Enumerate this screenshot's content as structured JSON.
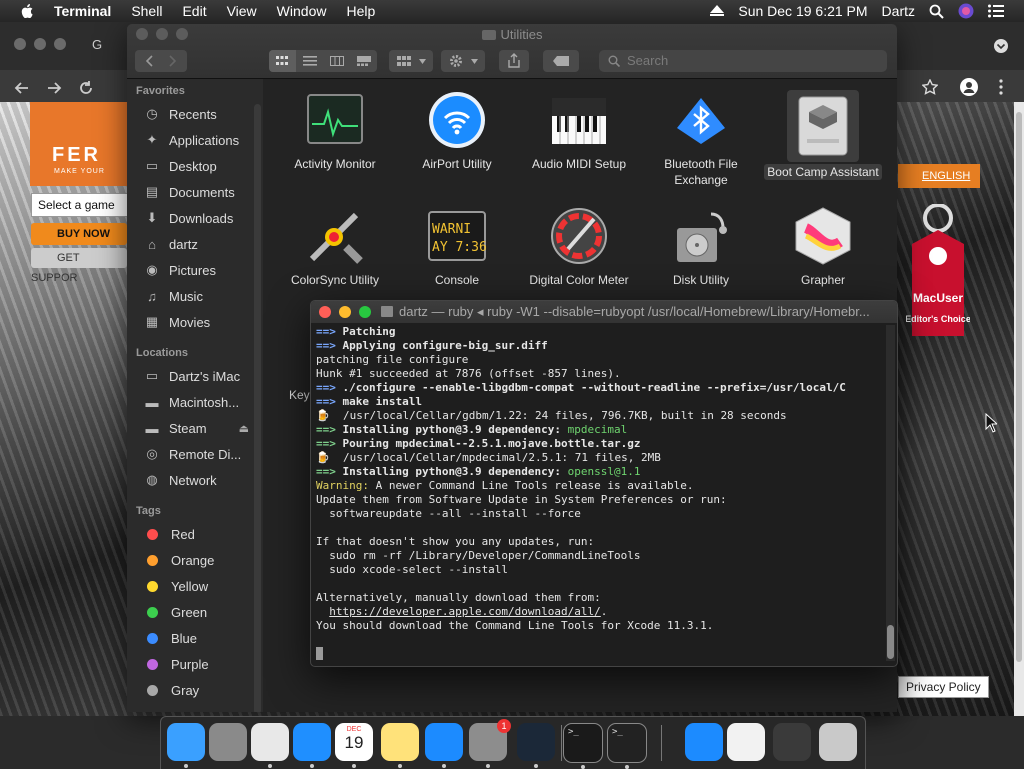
{
  "menubar": {
    "app_name": "Terminal",
    "items": [
      "Shell",
      "Edit",
      "View",
      "Window",
      "Help"
    ],
    "clock": "Sun Dec 19  6:21 PM",
    "user": "Dartz"
  },
  "browser": {
    "tab_label": "G",
    "english_label": "ENGLISH",
    "select_game": "Select a game",
    "buy_now": "BUY NOW",
    "get_support": "GET SUPPOR",
    "ferrari_text": "FER",
    "ferrari_sub": "MAKE YOUR",
    "macuser_title": "MacUser",
    "macuser_sub": "Editor's Choice",
    "privacy": "Privacy Policy"
  },
  "finder": {
    "title": "Utilities",
    "search_placeholder": "Search",
    "sidebar": {
      "favorites_header": "Favorites",
      "favorites": [
        {
          "label": "Recents",
          "icon": "clock-icon"
        },
        {
          "label": "Applications",
          "icon": "applications-icon"
        },
        {
          "label": "Desktop",
          "icon": "desktop-icon"
        },
        {
          "label": "Documents",
          "icon": "document-icon"
        },
        {
          "label": "Downloads",
          "icon": "download-icon"
        },
        {
          "label": "dartz",
          "icon": "home-icon"
        },
        {
          "label": "Pictures",
          "icon": "camera-icon"
        },
        {
          "label": "Music",
          "icon": "music-icon"
        },
        {
          "label": "Movies",
          "icon": "film-icon"
        }
      ],
      "locations_header": "Locations",
      "locations": [
        {
          "label": "Dartz's iMac",
          "icon": "imac-icon"
        },
        {
          "label": "Macintosh...",
          "icon": "disk-icon"
        },
        {
          "label": "Steam",
          "icon": "disk-icon"
        },
        {
          "label": "Remote Di...",
          "icon": "disc-icon"
        },
        {
          "label": "Network",
          "icon": "network-icon"
        }
      ],
      "tags_header": "Tags",
      "tags": [
        {
          "label": "Red",
          "color": "#ff4d4d"
        },
        {
          "label": "Orange",
          "color": "#ff9f2e"
        },
        {
          "label": "Yellow",
          "color": "#ffd92e"
        },
        {
          "label": "Green",
          "color": "#3ccf4e"
        },
        {
          "label": "Blue",
          "color": "#3b8cff"
        },
        {
          "label": "Purple",
          "color": "#c067e0"
        },
        {
          "label": "Gray",
          "color": "#a8a8a8"
        }
      ]
    },
    "apps": [
      {
        "label": "Activity Monitor",
        "icon": "activity-monitor-icon"
      },
      {
        "label": "AirPort Utility",
        "icon": "airport-icon"
      },
      {
        "label": "Audio MIDI Setup",
        "icon": "piano-icon"
      },
      {
        "label": "Bluetooth File Exchange",
        "icon": "bluetooth-icon"
      },
      {
        "label": "Boot Camp Assistant",
        "icon": "bootcamp-icon"
      },
      {
        "label": "ColorSync Utility",
        "icon": "colorsync-icon"
      },
      {
        "label": "Console",
        "icon": "console-icon"
      },
      {
        "label": "Digital Color Meter",
        "icon": "color-meter-icon"
      },
      {
        "label": "Disk Utility",
        "icon": "disk-utility-icon"
      },
      {
        "label": "Grapher",
        "icon": "grapher-icon"
      }
    ],
    "console_icon_text": [
      "WARNI",
      "AY 7:36"
    ],
    "partial_label": "Key"
  },
  "terminal": {
    "title": "dartz — ruby ◂ ruby -W1 --disable=rubyopt /usr/local/Homebrew/Library/Homebr...",
    "lines": [
      [
        {
          "c": "ar",
          "t": "==> "
        },
        {
          "c": "bd",
          "t": "Patching"
        }
      ],
      [
        {
          "c": "ar",
          "t": "==> "
        },
        {
          "c": "bd",
          "t": "Applying configure-big_sur.diff"
        }
      ],
      [
        {
          "c": "",
          "t": "patching file configure"
        }
      ],
      [
        {
          "c": "",
          "t": "Hunk #1 succeeded at 7876 (offset -857 lines)."
        }
      ],
      [
        {
          "c": "ar",
          "t": "==> "
        },
        {
          "c": "bd",
          "t": "./configure --enable-libgdbm-compat --without-readline --prefix=/usr/local/C"
        }
      ],
      [
        {
          "c": "ar",
          "t": "==> "
        },
        {
          "c": "bd",
          "t": "make install"
        }
      ],
      [
        {
          "c": "beer",
          "t": "🍺  "
        },
        {
          "c": "",
          "t": "/usr/local/Cellar/gdbm/1.22: 24 files, 796.7KB, built in 28 seconds"
        }
      ],
      [
        {
          "c": "ag",
          "t": "==> "
        },
        {
          "c": "bd",
          "t": "Installing python@3.9 dependency: "
        },
        {
          "c": "gn",
          "t": "mpdecimal"
        }
      ],
      [
        {
          "c": "ag",
          "t": "==> "
        },
        {
          "c": "bd",
          "t": "Pouring mpdecimal--2.5.1.mojave.bottle.tar.gz"
        }
      ],
      [
        {
          "c": "beer",
          "t": "🍺  "
        },
        {
          "c": "",
          "t": "/usr/local/Cellar/mpdecimal/2.5.1: 71 files, 2MB"
        }
      ],
      [
        {
          "c": "ag",
          "t": "==> "
        },
        {
          "c": "bd",
          "t": "Installing python@3.9 dependency: "
        },
        {
          "c": "gn",
          "t": "openssl@1.1"
        }
      ],
      [
        {
          "c": "yl",
          "t": "Warning:"
        },
        {
          "c": "",
          "t": " A newer Command Line Tools release is available."
        }
      ],
      [
        {
          "c": "",
          "t": "Update them from Software Update in System Preferences or run:"
        }
      ],
      [
        {
          "c": "",
          "t": "  softwareupdate --all --install --force"
        }
      ],
      [
        {
          "c": "",
          "t": ""
        }
      ],
      [
        {
          "c": "",
          "t": "If that doesn't show you any updates, run:"
        }
      ],
      [
        {
          "c": "",
          "t": "  sudo rm -rf /Library/Developer/CommandLineTools"
        }
      ],
      [
        {
          "c": "",
          "t": "  sudo xcode-select --install"
        }
      ],
      [
        {
          "c": "",
          "t": ""
        }
      ],
      [
        {
          "c": "",
          "t": "Alternatively, manually download them from:"
        }
      ],
      [
        {
          "c": "",
          "t": "  "
        },
        {
          "c": "ul",
          "t": "https://developer.apple.com/download/all/"
        },
        {
          "c": "",
          "t": "."
        }
      ],
      [
        {
          "c": "",
          "t": "You should download the Command Line Tools for Xcode 11.3.1."
        }
      ]
    ]
  },
  "dock": {
    "apps": [
      {
        "name": "finder-icon",
        "color": "#3aa0ff"
      },
      {
        "name": "launchpad-icon",
        "color": "#8a8a8a"
      },
      {
        "name": "chrome-icon",
        "color": "#e8e8e8"
      },
      {
        "name": "safari-icon",
        "color": "#1f8fff"
      },
      {
        "name": "calendar-icon",
        "color": "#ffffff"
      },
      {
        "name": "notes-icon",
        "color": "#ffe27a"
      },
      {
        "name": "app-store-icon",
        "color": "#1c8bff"
      },
      {
        "name": "system-preferences-icon",
        "color": "#8d8d8d"
      },
      {
        "name": "steam-icon",
        "color": "#1b2838"
      },
      {
        "name": "terminal-icon",
        "color": "#1a1a1a"
      },
      {
        "name": "console-icon",
        "color": "#222222"
      },
      {
        "name": "app-store-folder-icon",
        "color": "#1c8bff"
      },
      {
        "name": "document-icon",
        "color": "#f2f2f2"
      },
      {
        "name": "screenshot-icon",
        "color": "#3a3a3a"
      },
      {
        "name": "trash-icon",
        "color": "#c9c9c9"
      }
    ],
    "calendar_month": "DEC",
    "calendar_day": "19",
    "badge_count": "1"
  }
}
